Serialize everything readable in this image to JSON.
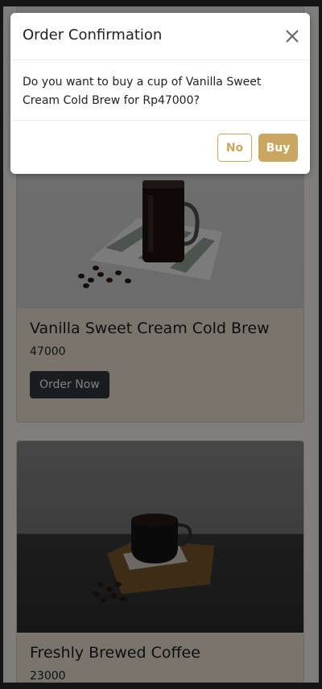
{
  "modal": {
    "title": "Order Confirmation",
    "close_icon": "close-icon",
    "message": "Do you want to buy a cup of Vanilla Sweet Cream Cold Brew for Rp47000?",
    "no_label": "No",
    "buy_label": "Buy",
    "accent_color": "#c9a760"
  },
  "products": [
    {
      "title": "Vanilla Sweet Cream Cold Brew",
      "price": "47000",
      "button_label": "Order Now"
    },
    {
      "title": "Freshly Brewed Coffee",
      "price": "23000"
    }
  ]
}
